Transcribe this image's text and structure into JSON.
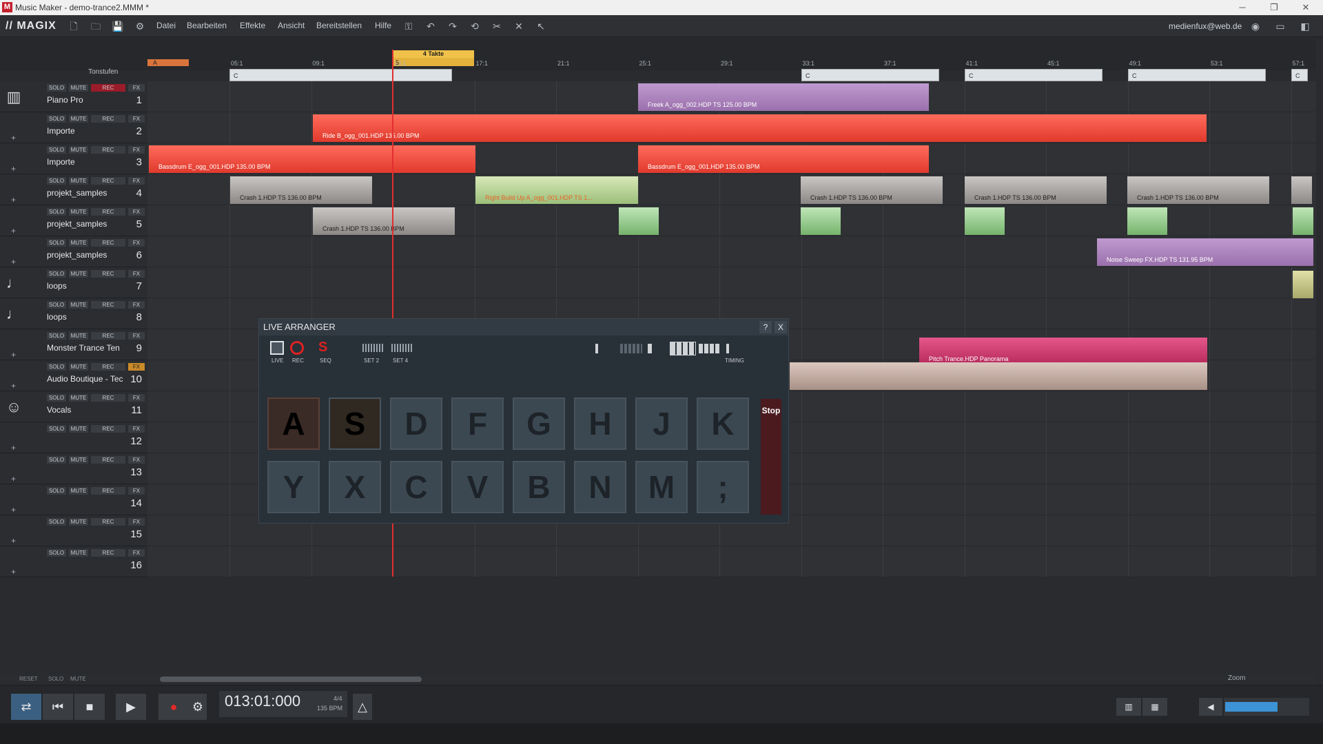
{
  "window": {
    "title": "Music Maker - demo-trance2.MMM *",
    "app_icon": "M"
  },
  "menubar": {
    "logo": "// MAGIX",
    "items": [
      "Datei",
      "Bearbeiten",
      "Effekte",
      "Ansicht",
      "Bereitstellen",
      "Hilfe"
    ],
    "user": "medienfux@web.de"
  },
  "ruler": {
    "tonstufen": "Tonstufen",
    "marker": "A",
    "loop_label": "4 Takte",
    "playhead_label": "5",
    "ticks": [
      "05:1",
      "09:1",
      "13:1",
      "17:1",
      "21:1",
      "25:1",
      "29:1",
      "33:1",
      "37:1",
      "41:1",
      "45:1",
      "49:1",
      "53:1",
      "57:1"
    ],
    "chord": "C"
  },
  "track_buttons": {
    "solo": "SOLO",
    "mute": "MUTE",
    "rec": "REC",
    "fx": "FX"
  },
  "tracks": [
    {
      "name": "Piano Pro",
      "num": "1"
    },
    {
      "name": "Importe",
      "num": "2"
    },
    {
      "name": "Importe",
      "num": "3"
    },
    {
      "name": "projekt_samples",
      "num": "4"
    },
    {
      "name": "projekt_samples",
      "num": "5"
    },
    {
      "name": "projekt_samples",
      "num": "6"
    },
    {
      "name": "loops",
      "num": "7"
    },
    {
      "name": "loops",
      "num": "8"
    },
    {
      "name": "Monster Trance Ten",
      "num": "9"
    },
    {
      "name": "Audio Boutique - Tec",
      "num": "10"
    },
    {
      "name": "Vocals",
      "num": "11"
    },
    {
      "name": "",
      "num": "12"
    },
    {
      "name": "",
      "num": "13"
    },
    {
      "name": "",
      "num": "14"
    },
    {
      "name": "",
      "num": "15"
    },
    {
      "name": "",
      "num": "16"
    }
  ],
  "clips": {
    "freek": "Freek A_ogg_002.HDP  TS  125.00 BPM",
    "ride": "Ride B_ogg_001.HDP  135.00 BPM",
    "bassdrum": "Bassdrum E_ogg_001.HDP  135.00 BPM",
    "crash": "Crash 1.HDP  TS  136.00 BPM",
    "buildup": "Right Build Up A_ogg_001.HDP  TS  1...",
    "noise": "Noise Sweep FX.HDP  TS  131.95 BPM",
    "pitch": "Pitch Trance.HDP  Panorama"
  },
  "live_arranger": {
    "title": "LIVE ARRANGER",
    "help": "?",
    "close": "X",
    "labels": {
      "live": "LIVE",
      "rec": "REC",
      "seq": "SEQ",
      "set2": "SET 2",
      "set4": "SET 4",
      "timing": "TIMING"
    },
    "pads_row1": [
      "A",
      "S",
      "D",
      "F",
      "G",
      "H",
      "J",
      "K"
    ],
    "pads_row2": [
      "Y",
      "X",
      "C",
      "V",
      "B",
      "N",
      "M",
      ";"
    ],
    "stop": "Stop"
  },
  "bottom": {
    "reset": "RESET",
    "solo": "SOLO",
    "mute": "MUTE",
    "zoom": "Zoom"
  },
  "transport": {
    "time": "013:01:000",
    "signature": "4/4",
    "bpm": "135 BPM"
  }
}
